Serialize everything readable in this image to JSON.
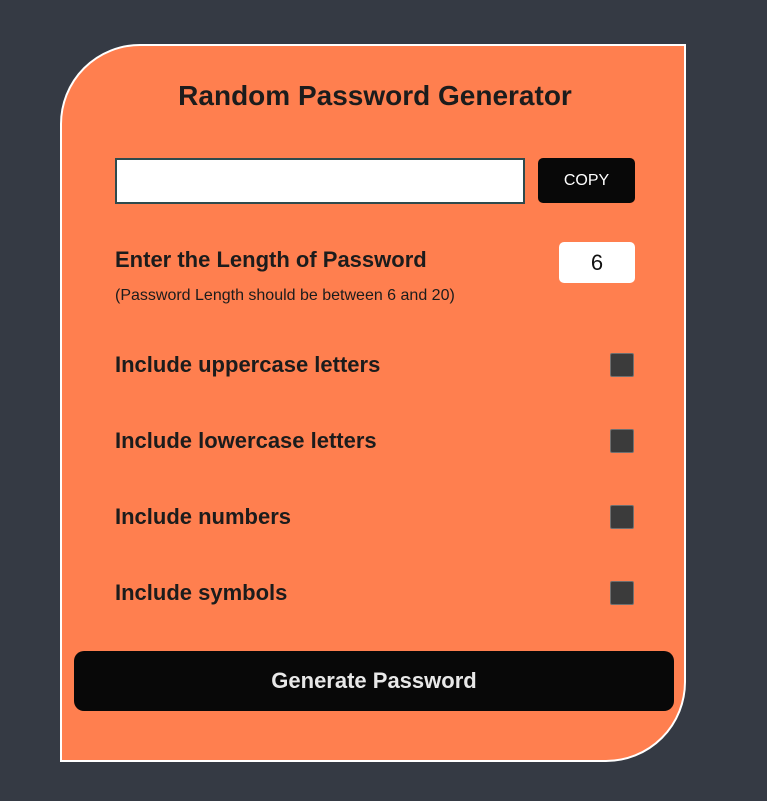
{
  "app": {
    "title": "Random Password Generator"
  },
  "password_field": {
    "value": "",
    "placeholder": ""
  },
  "copy_button": {
    "label": "COPY"
  },
  "length": {
    "label": "Enter the Length of Password",
    "hint": "(Password Length should be between 6 and 20)",
    "value": "6"
  },
  "options": [
    {
      "label": "Include uppercase letters",
      "checked": false
    },
    {
      "label": "Include lowercase letters",
      "checked": false
    },
    {
      "label": "Include numbers",
      "checked": false
    },
    {
      "label": "Include symbols",
      "checked": false
    }
  ],
  "generate_button": {
    "label": "Generate Password"
  },
  "colors": {
    "background": "#353a44",
    "card": "#ff7f4f",
    "button": "#080808",
    "checkbox": "#3b3b3b"
  }
}
